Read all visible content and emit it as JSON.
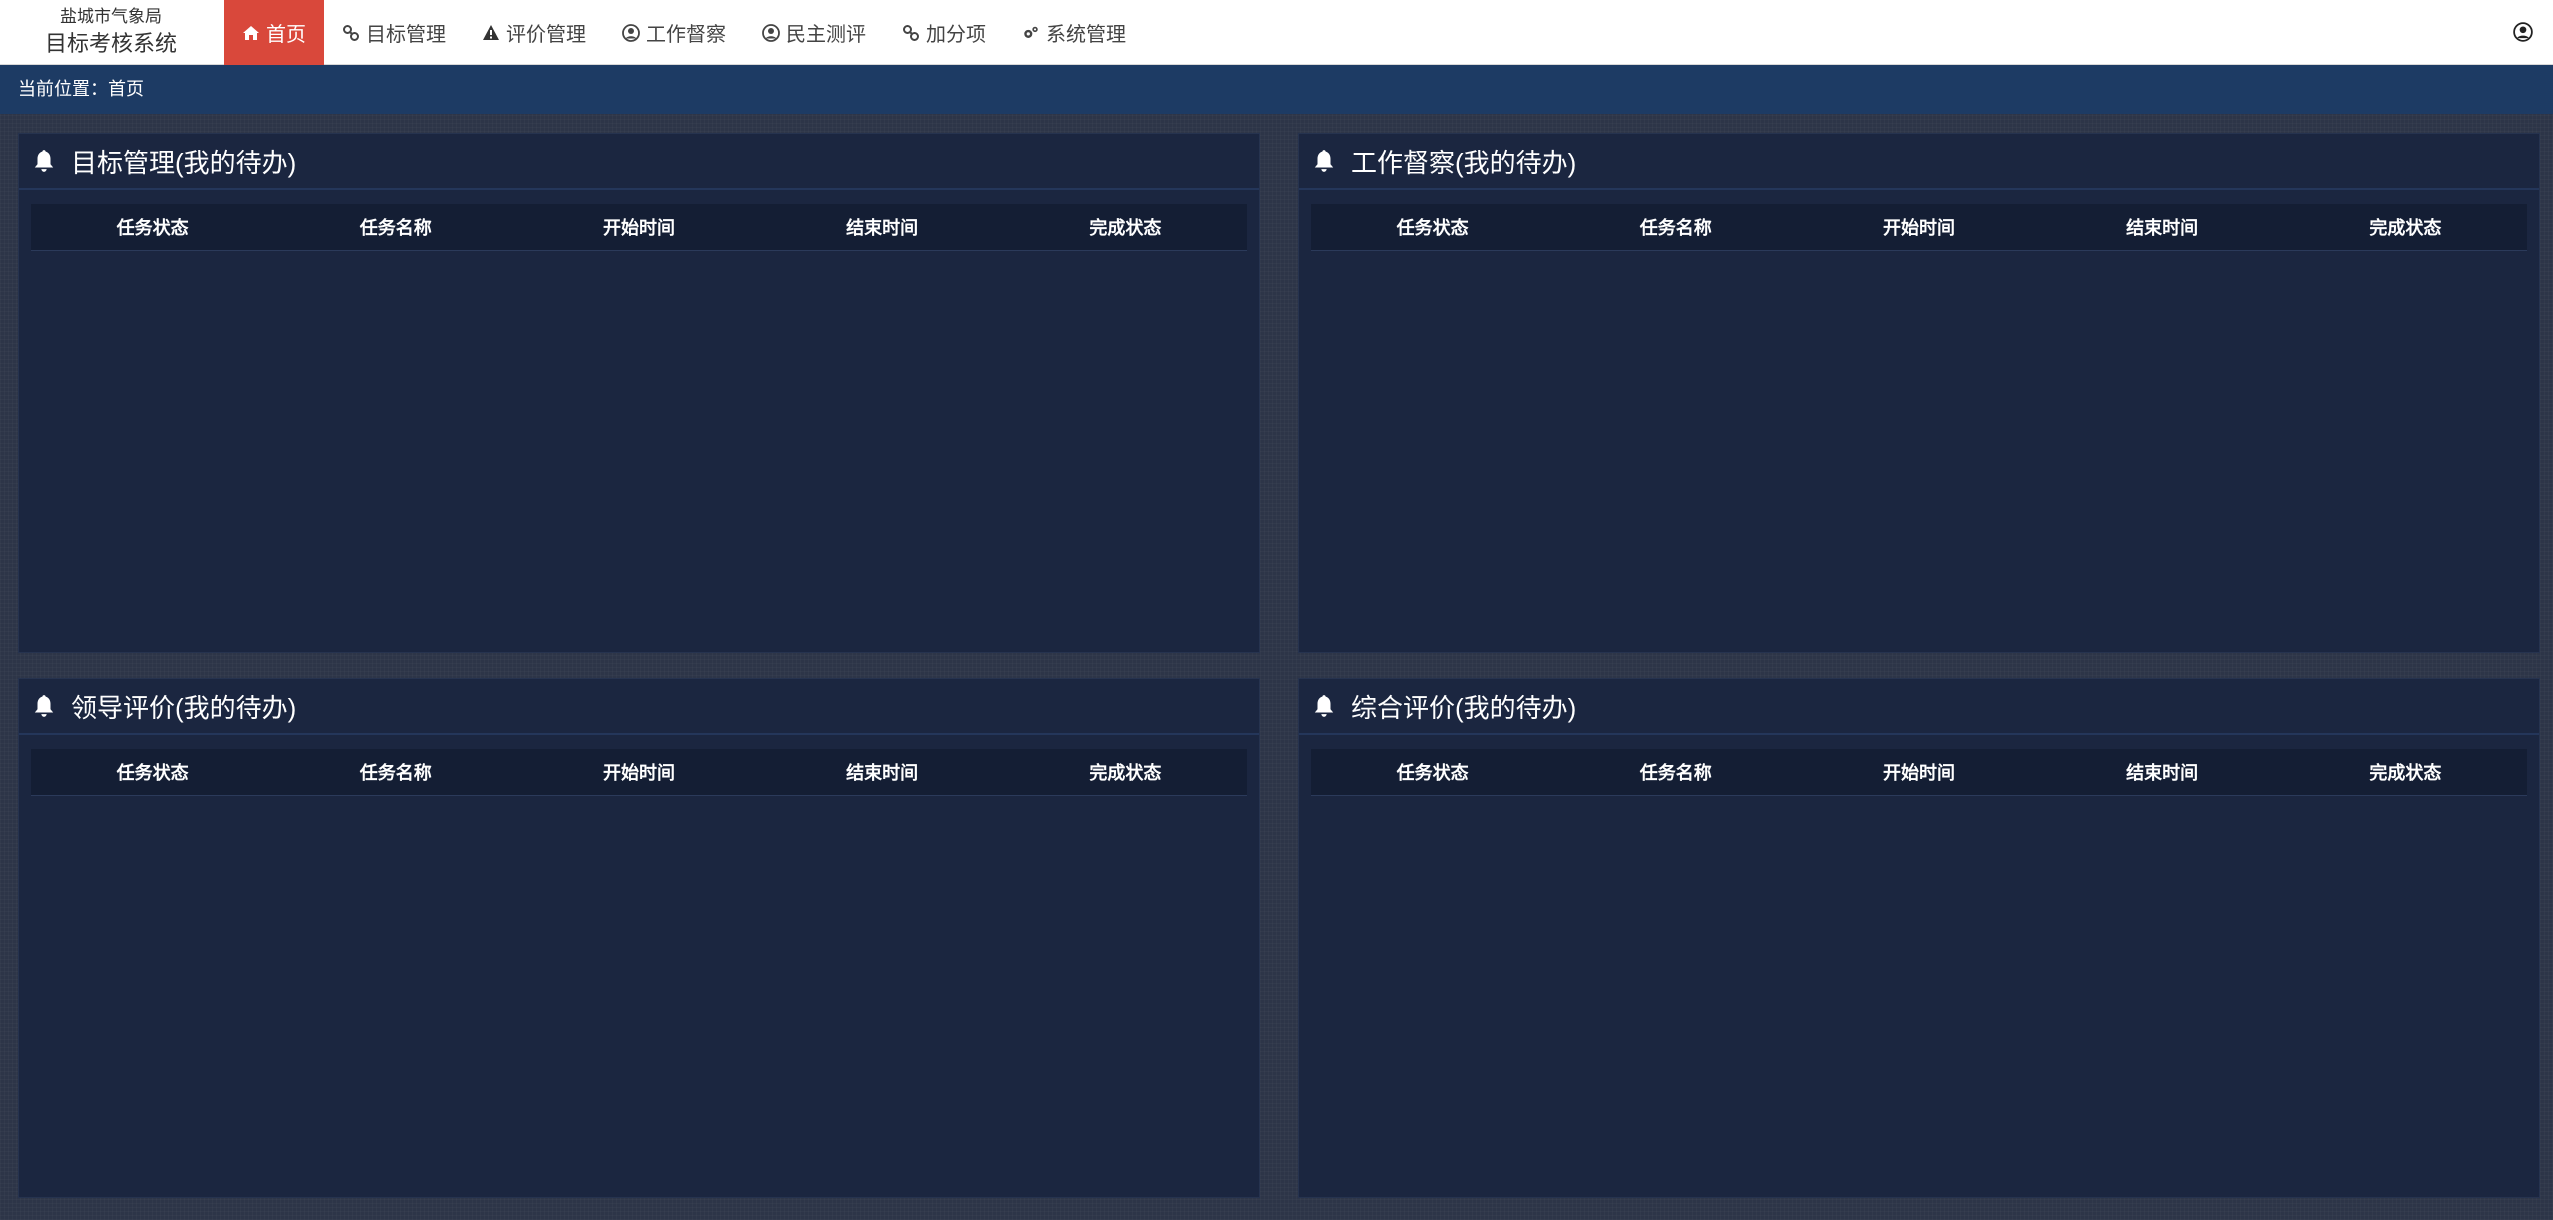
{
  "brand": {
    "org": "盐城市气象局",
    "system": "目标考核系统"
  },
  "menu": [
    {
      "label": "首页",
      "icon": "home-icon",
      "active": true
    },
    {
      "label": "目标管理",
      "icon": "link-icon",
      "active": false
    },
    {
      "label": "评价管理",
      "icon": "warning-icon",
      "active": false
    },
    {
      "label": "工作督察",
      "icon": "user-circle-icon",
      "active": false
    },
    {
      "label": "民主测评",
      "icon": "user-circle-icon",
      "active": false
    },
    {
      "label": "加分项",
      "icon": "link-icon",
      "active": false
    },
    {
      "label": "系统管理",
      "icon": "gears-icon",
      "active": false
    }
  ],
  "breadcrumb": {
    "text": "当前位置：首页"
  },
  "columns": [
    "任务状态",
    "任务名称",
    "开始时间",
    "结束时间",
    "完成状态"
  ],
  "panels": [
    {
      "title": "目标管理(我的待办)"
    },
    {
      "title": "工作督察(我的待办)"
    },
    {
      "title": "领导评价(我的待办)"
    },
    {
      "title": "综合评价(我的待办)"
    }
  ],
  "colors": {
    "accent": "#d9483b",
    "breadcrumb_bg": "#1d3b64",
    "panel_bg": "#1b2640",
    "page_bg": "#2d3548"
  }
}
